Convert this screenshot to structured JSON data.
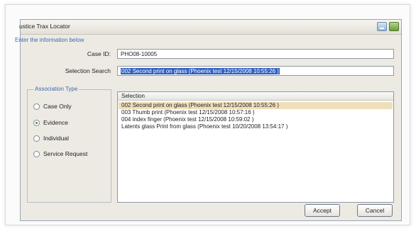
{
  "window": {
    "title": "ustice Trax Locator"
  },
  "form": {
    "instruction": "Enter the information below",
    "case_id_label": "Case ID:",
    "case_id_value": "PHO08-10005",
    "selection_search_label": "Selection Search",
    "selection_search_value": "002 Second print on glass (Phoenix test 12/15/2008 10:55:26 )"
  },
  "association": {
    "title": "Association Type",
    "options": [
      {
        "label": "Case Only",
        "checked": false
      },
      {
        "label": "Evidence",
        "checked": true
      },
      {
        "label": "Individual",
        "checked": false
      },
      {
        "label": "Service Request",
        "checked": false
      }
    ]
  },
  "selection_list": {
    "header": "Selection",
    "rows": [
      {
        "text": "002 Second print on glass (Phoenix test 12/15/2008 10:55:26 )",
        "selected": true
      },
      {
        "text": "003 Thumb print (Phoenix test 12/15/2008 10:57:16 )",
        "selected": false
      },
      {
        "text": "004 index finger (Phoenix test 12/15/2008 10:59:02 )",
        "selected": false
      },
      {
        "text": "Latents glass Print from glass (Phoenix test 10/20/2008 13:54:17 )",
        "selected": false
      }
    ]
  },
  "buttons": {
    "accept": "Accept",
    "cancel": "Cancel"
  }
}
